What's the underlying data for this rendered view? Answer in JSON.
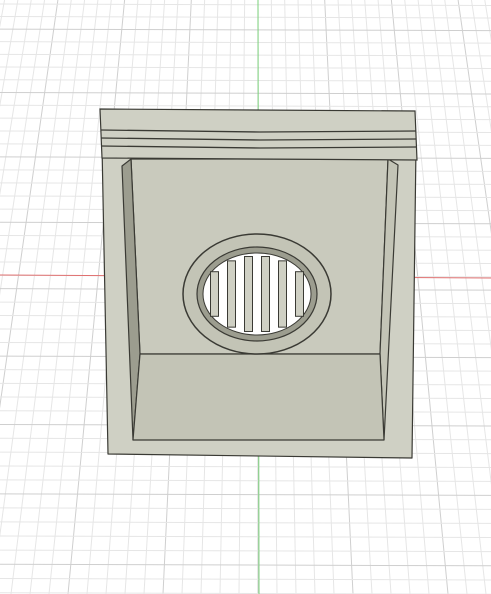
{
  "viewport": {
    "background": "#ffffff",
    "grid": {
      "visible": true,
      "minor_color": "#e6e6e6",
      "major_color": "#cfcfcf"
    },
    "axes": {
      "x_axis_color": "#e07070",
      "y_axis_color": "#7ad07a"
    }
  },
  "model": {
    "body_color": "#cfd0c4",
    "inner_wall_color": "#c3c4b6",
    "back_wall_color": "#c9cabd",
    "shadow_color": "#9c9d8f",
    "edge_color": "#3a3a34",
    "lid_ridges": 3,
    "vent_slots": 6
  }
}
